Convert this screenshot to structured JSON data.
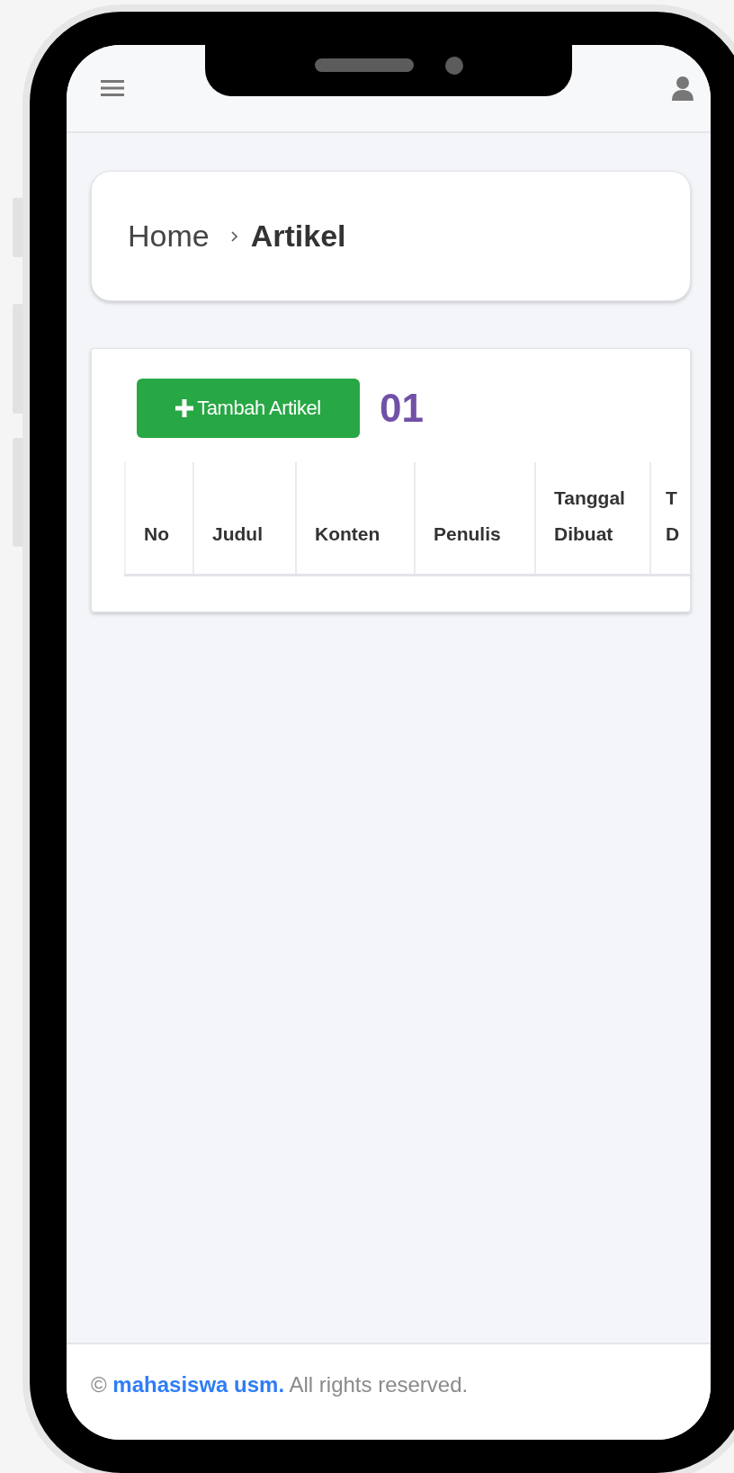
{
  "breadcrumb": {
    "items": [
      "Home",
      "Artikel"
    ]
  },
  "add_button": {
    "label": "Tambah Artikel"
  },
  "annotation": "01",
  "table": {
    "columns": [
      "No",
      "Judul",
      "Konten",
      "Penulis",
      "Tanggal Dibuat",
      "T D"
    ]
  },
  "footer": {
    "copyright": "©",
    "brand": "mahasiswa usm.",
    "text": "All rights reserved."
  }
}
